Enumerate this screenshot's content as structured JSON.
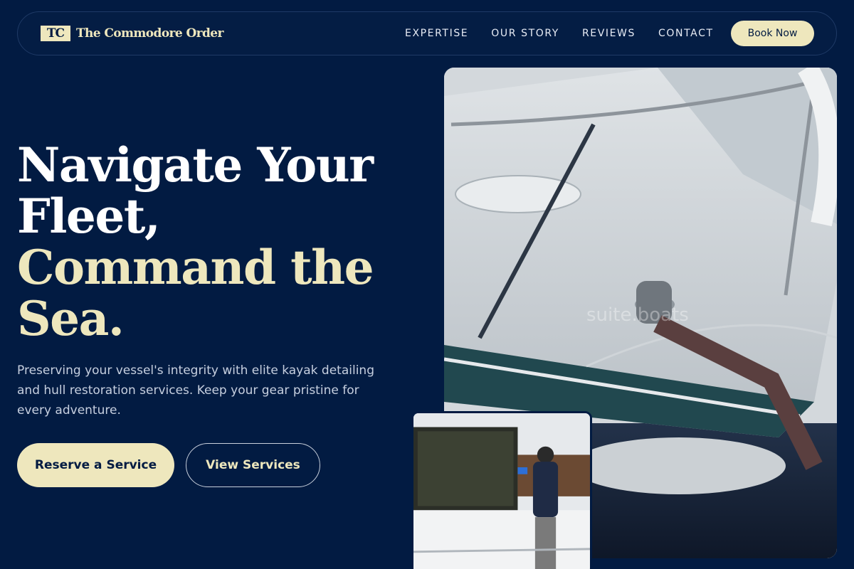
{
  "brand": {
    "mark": "TC",
    "name": "The Commodore Order"
  },
  "nav": {
    "links": [
      "EXPERTISE",
      "OUR STORY",
      "REVIEWS",
      "CONTACT"
    ],
    "cta": "Book Now"
  },
  "hero": {
    "title_line1": "Navigate Your",
    "title_line2": "Fleet,",
    "title_accent1": "Command the",
    "title_accent2": "Sea.",
    "description": "Preserving your vessel's integrity with elite kayak detailing and hull restoration services. Keep your gear pristine for every adventure.",
    "primary_cta": "Reserve a Service",
    "secondary_cta": "View Services"
  },
  "images": {
    "main_watermark": "suite.boats"
  },
  "colors": {
    "background": "#021b42",
    "accent": "#eee7bd",
    "text": "#ffffff"
  }
}
